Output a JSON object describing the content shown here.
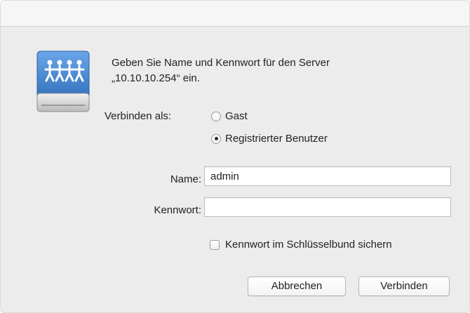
{
  "dialog": {
    "message_line1": "Geben Sie Name und Kennwort für den Server",
    "message_line2": "„10.10.10.254“ ein.",
    "icon": "shared-network-drive-icon"
  },
  "connect_as": {
    "label": "Verbinden als:",
    "options": [
      {
        "label": "Gast",
        "selected": false
      },
      {
        "label": "Registrierter Benutzer",
        "selected": true
      }
    ]
  },
  "form": {
    "name_label": "Name:",
    "name_value": "admin",
    "password_label": "Kennwort:",
    "password_value": "",
    "keychain_label": "Kennwort im Schlüsselbund sichern",
    "keychain_checked": false
  },
  "buttons": {
    "cancel": "Abbrechen",
    "connect": "Verbinden"
  },
  "colors": {
    "dialog_bg": "#ececec",
    "drive_blue": "#3f7ec9"
  }
}
